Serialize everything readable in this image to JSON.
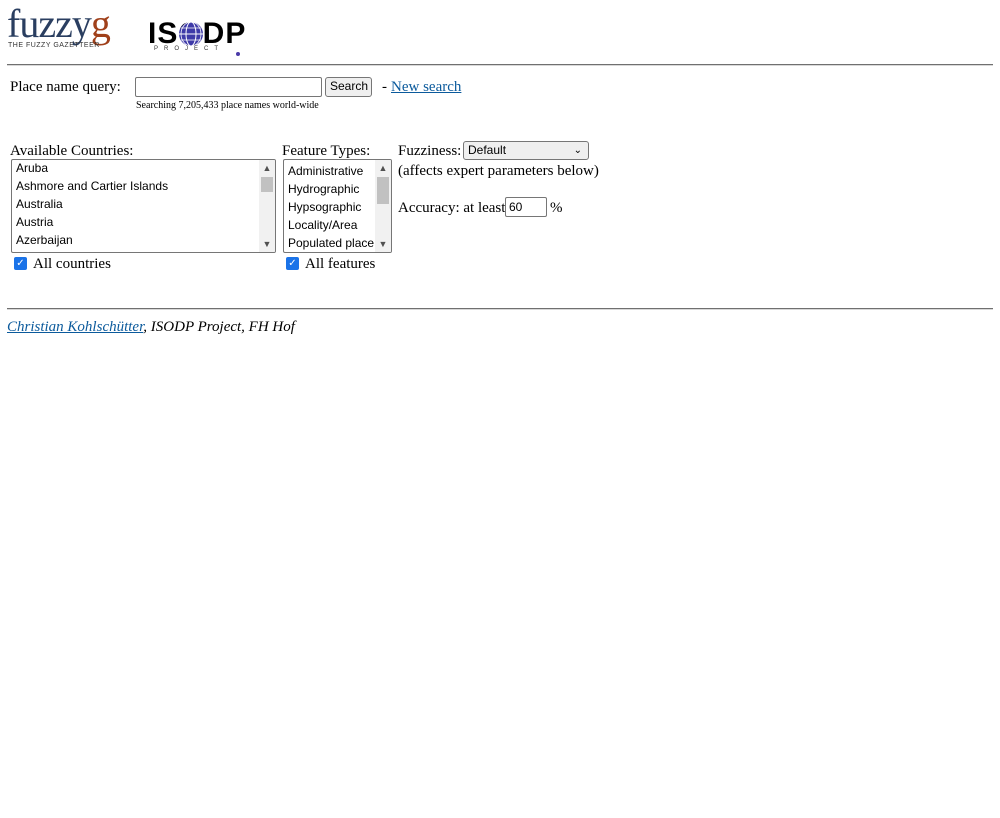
{
  "logos": {
    "fuzzyg_word": "fuzzy",
    "fuzzyg_letter": "g",
    "fuzzyg_tagline": "THE FUZZY GAZETTEER",
    "isodp_word": "ISODP",
    "isodp_sub": "PROJECT"
  },
  "query": {
    "label": "Place name query:",
    "value": "",
    "search_label": "Search",
    "separator": "-",
    "new_search_label": "New search",
    "hint": "Searching 7,205,433 place names world-wide"
  },
  "countries": {
    "label": "Available Countries:",
    "items": [
      "Aruba",
      "Ashmore and Cartier Islands",
      "Australia",
      "Austria",
      "Azerbaijan"
    ],
    "all_label": "All countries"
  },
  "features": {
    "label": "Feature Types:",
    "items": [
      "Administrative",
      "Hydrographic",
      "Hypsographic",
      "Locality/Area",
      "Populated place"
    ],
    "all_label": "All features"
  },
  "fuzziness": {
    "label": "Fuzziness:",
    "selected": "Default",
    "note": "(affects expert parameters below)"
  },
  "accuracy": {
    "label": "Accuracy: at least",
    "value": "60",
    "unit": "%"
  },
  "footer": {
    "author_link": "Christian Kohlschütter",
    "rest": ", ISODP Project, FH Hof"
  },
  "colors": {
    "link": "#0b5a9c",
    "checkbox": "#1a73e8"
  }
}
